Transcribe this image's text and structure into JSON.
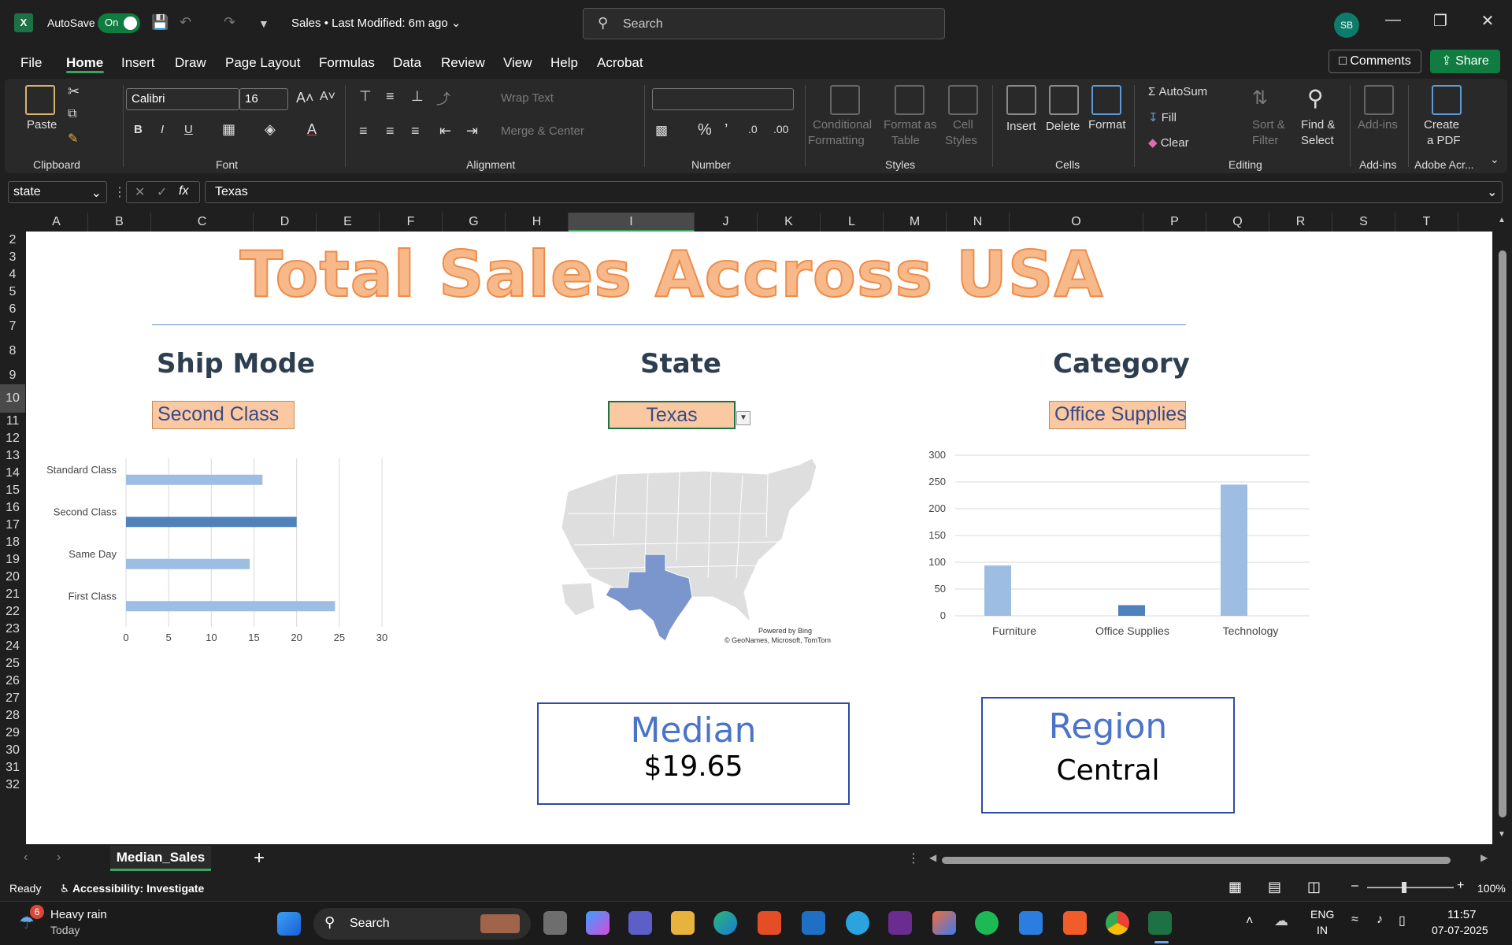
{
  "titlebar": {
    "autosave_label": "AutoSave",
    "autosave_state": "On",
    "doc_title": "Sales • Last Modified: 6m ago",
    "search_placeholder": "Search",
    "avatar_initials": "SB"
  },
  "menu": {
    "tabs": [
      "File",
      "Home",
      "Insert",
      "Draw",
      "Page Layout",
      "Formulas",
      "Data",
      "Review",
      "View",
      "Help",
      "Acrobat"
    ],
    "active": "Home",
    "comments_label": "Comments",
    "share_label": "Share"
  },
  "ribbon": {
    "clipboard": {
      "paste": "Paste",
      "label": "Clipboard"
    },
    "font": {
      "name": "Calibri",
      "size": "16",
      "bold": "B",
      "italic": "I",
      "underline": "U",
      "label": "Font"
    },
    "alignment": {
      "wrap": "Wrap Text",
      "merge": "Merge & Center",
      "label": "Alignment"
    },
    "number": {
      "format": "",
      "label": "Number"
    },
    "styles": {
      "conditional": "Conditional",
      "conditional2": "Formatting",
      "format_table": "Format as",
      "format_table2": "Table",
      "cell_styles": "Cell",
      "cell_styles2": "Styles",
      "label": "Styles"
    },
    "cells": {
      "insert": "Insert",
      "delete": "Delete",
      "format": "Format",
      "label": "Cells"
    },
    "editing": {
      "autosum": "AutoSum",
      "fill": "Fill",
      "clear": "Clear",
      "sort": "Sort &",
      "sort2": "Filter",
      "find": "Find &",
      "find2": "Select",
      "label": "Editing"
    },
    "addins": {
      "addins": "Add-ins",
      "label": "Add-ins"
    },
    "acrobat": {
      "create": "Create",
      "create2": "a PDF",
      "label": "Adobe Acr..."
    }
  },
  "formula_bar": {
    "name_box": "state",
    "content": "Texas"
  },
  "columns": [
    "A",
    "B",
    "C",
    "D",
    "E",
    "F",
    "G",
    "H",
    "I",
    "J",
    "K",
    "L",
    "M",
    "N",
    "O",
    "P",
    "Q",
    "R",
    "S",
    "T"
  ],
  "selected_column": "I",
  "rows": [
    "2",
    "3",
    "4",
    "5",
    "6",
    "7",
    "8",
    "9",
    "10",
    "11",
    "12",
    "13",
    "14",
    "15",
    "16",
    "17",
    "18",
    "19",
    "20",
    "21",
    "22",
    "23",
    "24",
    "25",
    "26",
    "27",
    "28",
    "29",
    "30",
    "31",
    "32"
  ],
  "selected_row": "10",
  "dashboard": {
    "title": "Total Sales Accross USA",
    "ship_mode": {
      "heading": "Ship Mode",
      "value": "Second Class"
    },
    "state": {
      "heading": "State",
      "value": "Texas"
    },
    "category": {
      "heading": "Category",
      "value": "Office Supplies"
    },
    "map": {
      "credit1": "Powered by Bing",
      "credit2": "© GeoNames, Microsoft, TomTom"
    },
    "median": {
      "heading": "Median",
      "value": "$19.65"
    },
    "region": {
      "heading": "Region",
      "value": "Central"
    }
  },
  "chart_data": [
    {
      "type": "bar",
      "orientation": "horizontal",
      "categories": [
        "Standard Class",
        "Second Class",
        "Same Day",
        "First Class"
      ],
      "values": [
        16,
        20,
        14.5,
        24.5
      ],
      "highlight": "Second Class",
      "xlim": [
        0,
        30
      ],
      "xticks": [
        0,
        5,
        10,
        15,
        20,
        25,
        30
      ],
      "colors": {
        "normal": "#9dbde3",
        "highlight": "#4f81bd"
      },
      "grid": true
    },
    {
      "type": "bar",
      "categories": [
        "Furniture",
        "Office Supplies",
        "Technology"
      ],
      "values": [
        94,
        20,
        245
      ],
      "highlight": "Office Supplies",
      "ylim": [
        0,
        300
      ],
      "yticks": [
        0,
        50,
        100,
        150,
        200,
        250,
        300
      ],
      "colors": {
        "normal": "#9dbde3",
        "highlight": "#4f81bd"
      },
      "grid": true
    }
  ],
  "sheet_tabs": {
    "active": "Median_Sales"
  },
  "status": {
    "ready": "Ready",
    "accessibility": "Accessibility: Investigate",
    "zoom": "100%"
  },
  "taskbar": {
    "weather_badge": "6",
    "weather": "Heavy rain",
    "weather_sub": "Today",
    "search": "Search",
    "lang": "ENG",
    "lang2": "IN",
    "time": "11:57",
    "date": "07-07-2025"
  }
}
